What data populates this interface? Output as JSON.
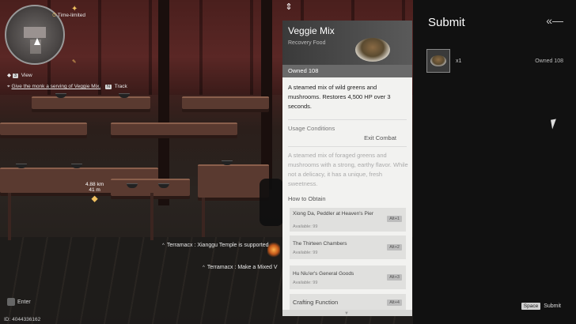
{
  "hud": {
    "quest_tag": "Time-limited",
    "view_key": "3",
    "view_label": "View",
    "quest_text": "Give the monk a serving of Veggie Mix.",
    "track_key": "N",
    "track_label": "Track",
    "distance": "4.88 km",
    "height": "41 m",
    "enter_label": "Enter",
    "player_id": "ID: 4044336162"
  },
  "chat": {
    "line1": "Terramacx : Xianggu Temple is supported",
    "line2": "Terramacx : Make a Mixed V"
  },
  "item_card": {
    "name": "Veggie Mix",
    "category": "Recovery Food",
    "owned": "Owned 108",
    "effect": "A steamed mix of wild greens and mushrooms. Restores 4,500 HP over 3 seconds.",
    "usage_label": "Usage Conditions",
    "usage_value": "Exit Combat",
    "flavor": "A steamed mix of foraged greens and mushrooms with a strong, earthy flavor. While not a delicacy, it has a unique, fresh sweetness.",
    "how_to_obtain": "How to Obtain",
    "sources": [
      {
        "name": "Xiong Da, Peddler at Heaven's Pier",
        "available": "Available: 99",
        "key": "Alt+1"
      },
      {
        "name": "The Thirteen Chambers",
        "available": "Available: 99",
        "key": "Alt+2"
      },
      {
        "name": "Hu Niu'er's General Goods",
        "available": "Available: 99",
        "key": "Alt+3"
      },
      {
        "name": "Crafting Function",
        "available": "",
        "key": "Alt+4"
      }
    ]
  },
  "submit_panel": {
    "title": "Submit",
    "quantity": "x1",
    "owned": "Owned 108",
    "submit_key": "Space",
    "submit_label": "Submit"
  },
  "icons": [
    "back-arrow-icon",
    "collapse-icon",
    "cursor-icon",
    "quest-diamond-icon",
    "player-arrow-icon"
  ]
}
